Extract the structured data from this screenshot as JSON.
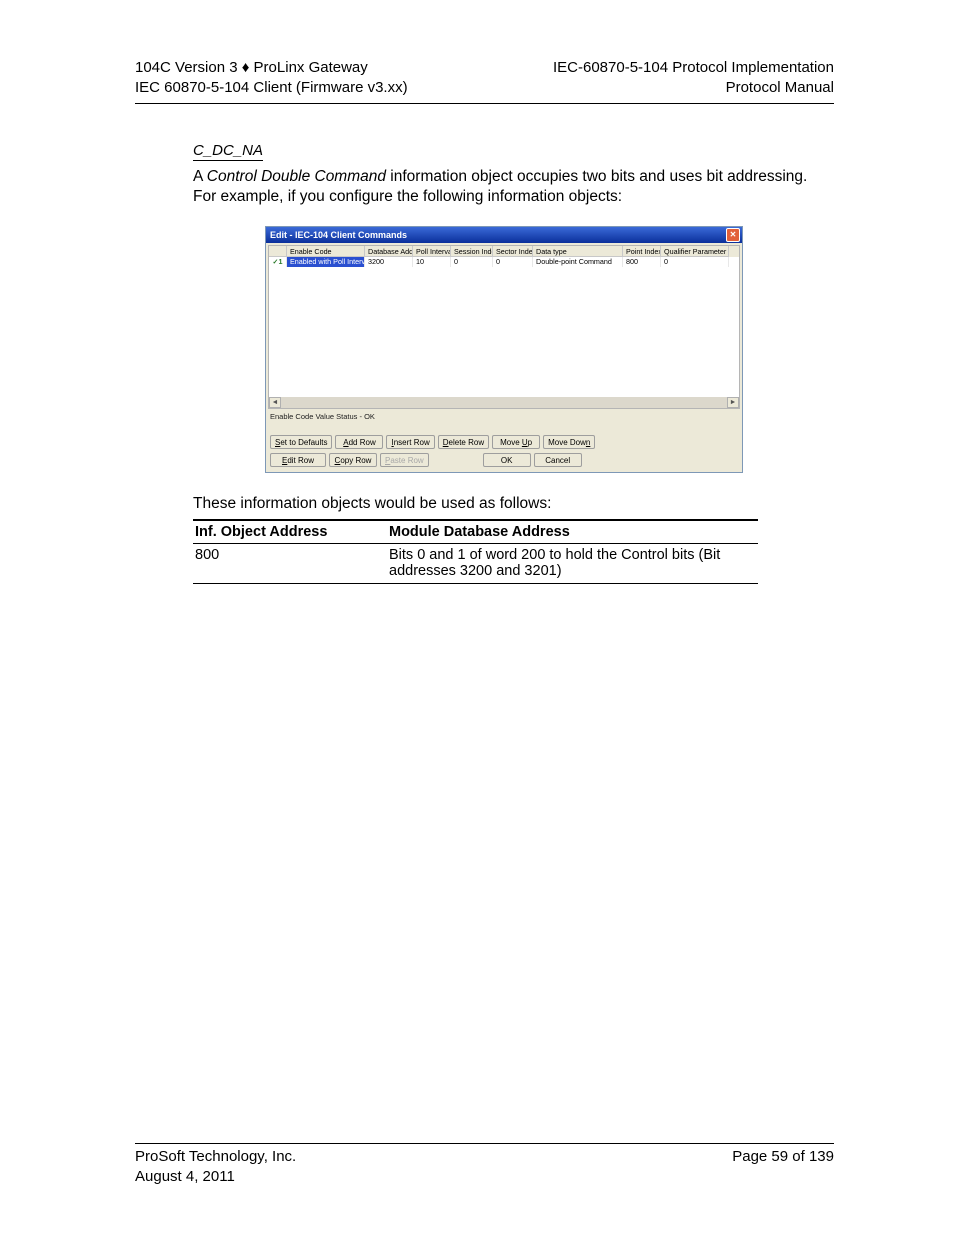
{
  "header": {
    "left1": "104C Version 3 ♦ ProLinx Gateway",
    "left2": "IEC 60870-5-104 Client (Firmware v3.xx)",
    "right1": "IEC-60870-5-104 Protocol Implementation",
    "right2": "Protocol Manual"
  },
  "section": {
    "title": "C_DC_NA",
    "para_prefix": "A ",
    "para_italic": "Control Double Command",
    "para_rest": " information object occupies two bits and uses bit addressing. For example, if you configure the following information objects:"
  },
  "dialog": {
    "title": "Edit - IEC-104 Client Commands",
    "columns": [
      "",
      "Enable Code",
      "Database Address",
      "Poll Interval",
      "Session Index",
      "Sector Index",
      "Data type",
      "Point Index",
      "Qualifier Parameter"
    ],
    "row": {
      "mark": "✓1",
      "enable": "Enabled with Poll Interval",
      "dbaddr": "3200",
      "poll": "10",
      "sess": "0",
      "sector": "0",
      "dtype": "Double-point Command",
      "pidx": "800",
      "qual": "0"
    },
    "status": "Enable Code Value Status - OK",
    "buttons_row1": [
      "Set to Defaults",
      "Add Row",
      "Insert Row",
      "Delete Row",
      "Move Up",
      "Move Down"
    ],
    "buttons_row2": [
      "Edit Row",
      "Copy Row",
      "Paste Row",
      "",
      "OK",
      "Cancel"
    ]
  },
  "after_para": "These information objects would be used as follows:",
  "table": {
    "h1": "Inf. Object Address",
    "h2": "Module Database Address",
    "r1c1": "800",
    "r1c2": "Bits 0 and 1 of word 200 to hold the Control bits (Bit addresses 3200 and 3201)"
  },
  "footer": {
    "left1": "ProSoft Technology, Inc.",
    "left2": "August 4, 2011",
    "right1": "Page 59 of 139"
  }
}
